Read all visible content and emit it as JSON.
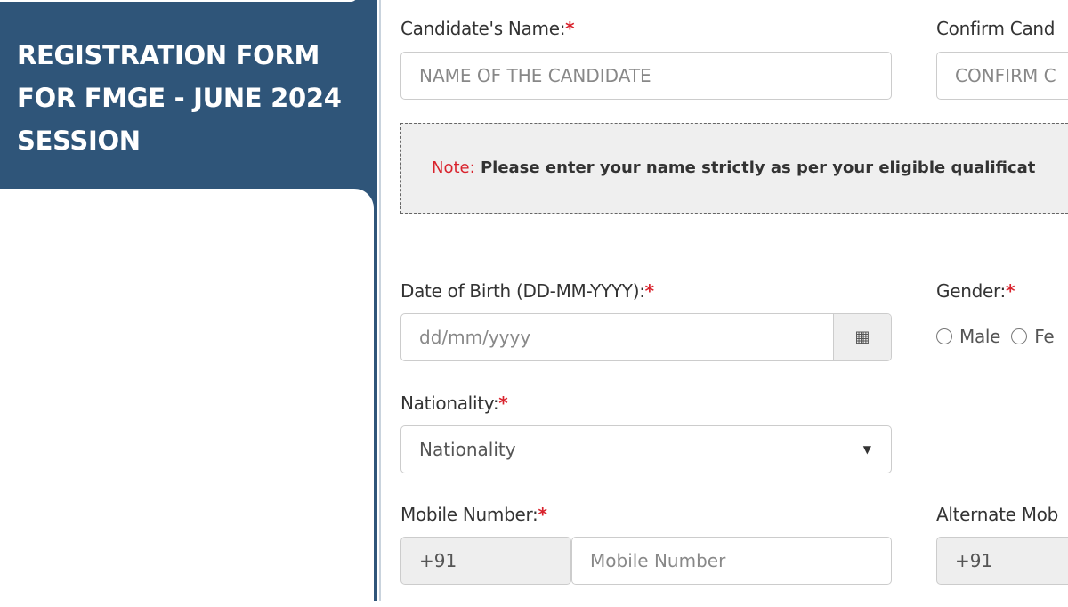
{
  "sidebar": {
    "title": "REGISTRATION FORM FOR FMGE - JUNE 2024 SESSION"
  },
  "form": {
    "candidate_name": {
      "label": "Candidate's Name:",
      "placeholder": "NAME OF THE CANDIDATE"
    },
    "confirm_name": {
      "label": "Confirm Cand",
      "placeholder": "CONFIRM C"
    },
    "note": {
      "prefix": "Note:",
      "text": "Please enter your name strictly as per your eligible qualificat"
    },
    "dob": {
      "label": "Date of Birth (DD-MM-YYYY):",
      "placeholder": "dd/mm/yyyy",
      "icon": "calendar-icon"
    },
    "gender": {
      "label": "Gender:",
      "options": [
        "Male",
        "Fe"
      ]
    },
    "nationality": {
      "label": "Nationality:",
      "value": "Nationality"
    },
    "mobile": {
      "label": "Mobile Number:",
      "code": "+91",
      "placeholder": "Mobile Number"
    },
    "alt_mobile": {
      "label": "Alternate Mob",
      "code": "+91"
    },
    "required_mark": "*"
  },
  "colors": {
    "header": "#2f5579",
    "required": "#d9232d"
  }
}
